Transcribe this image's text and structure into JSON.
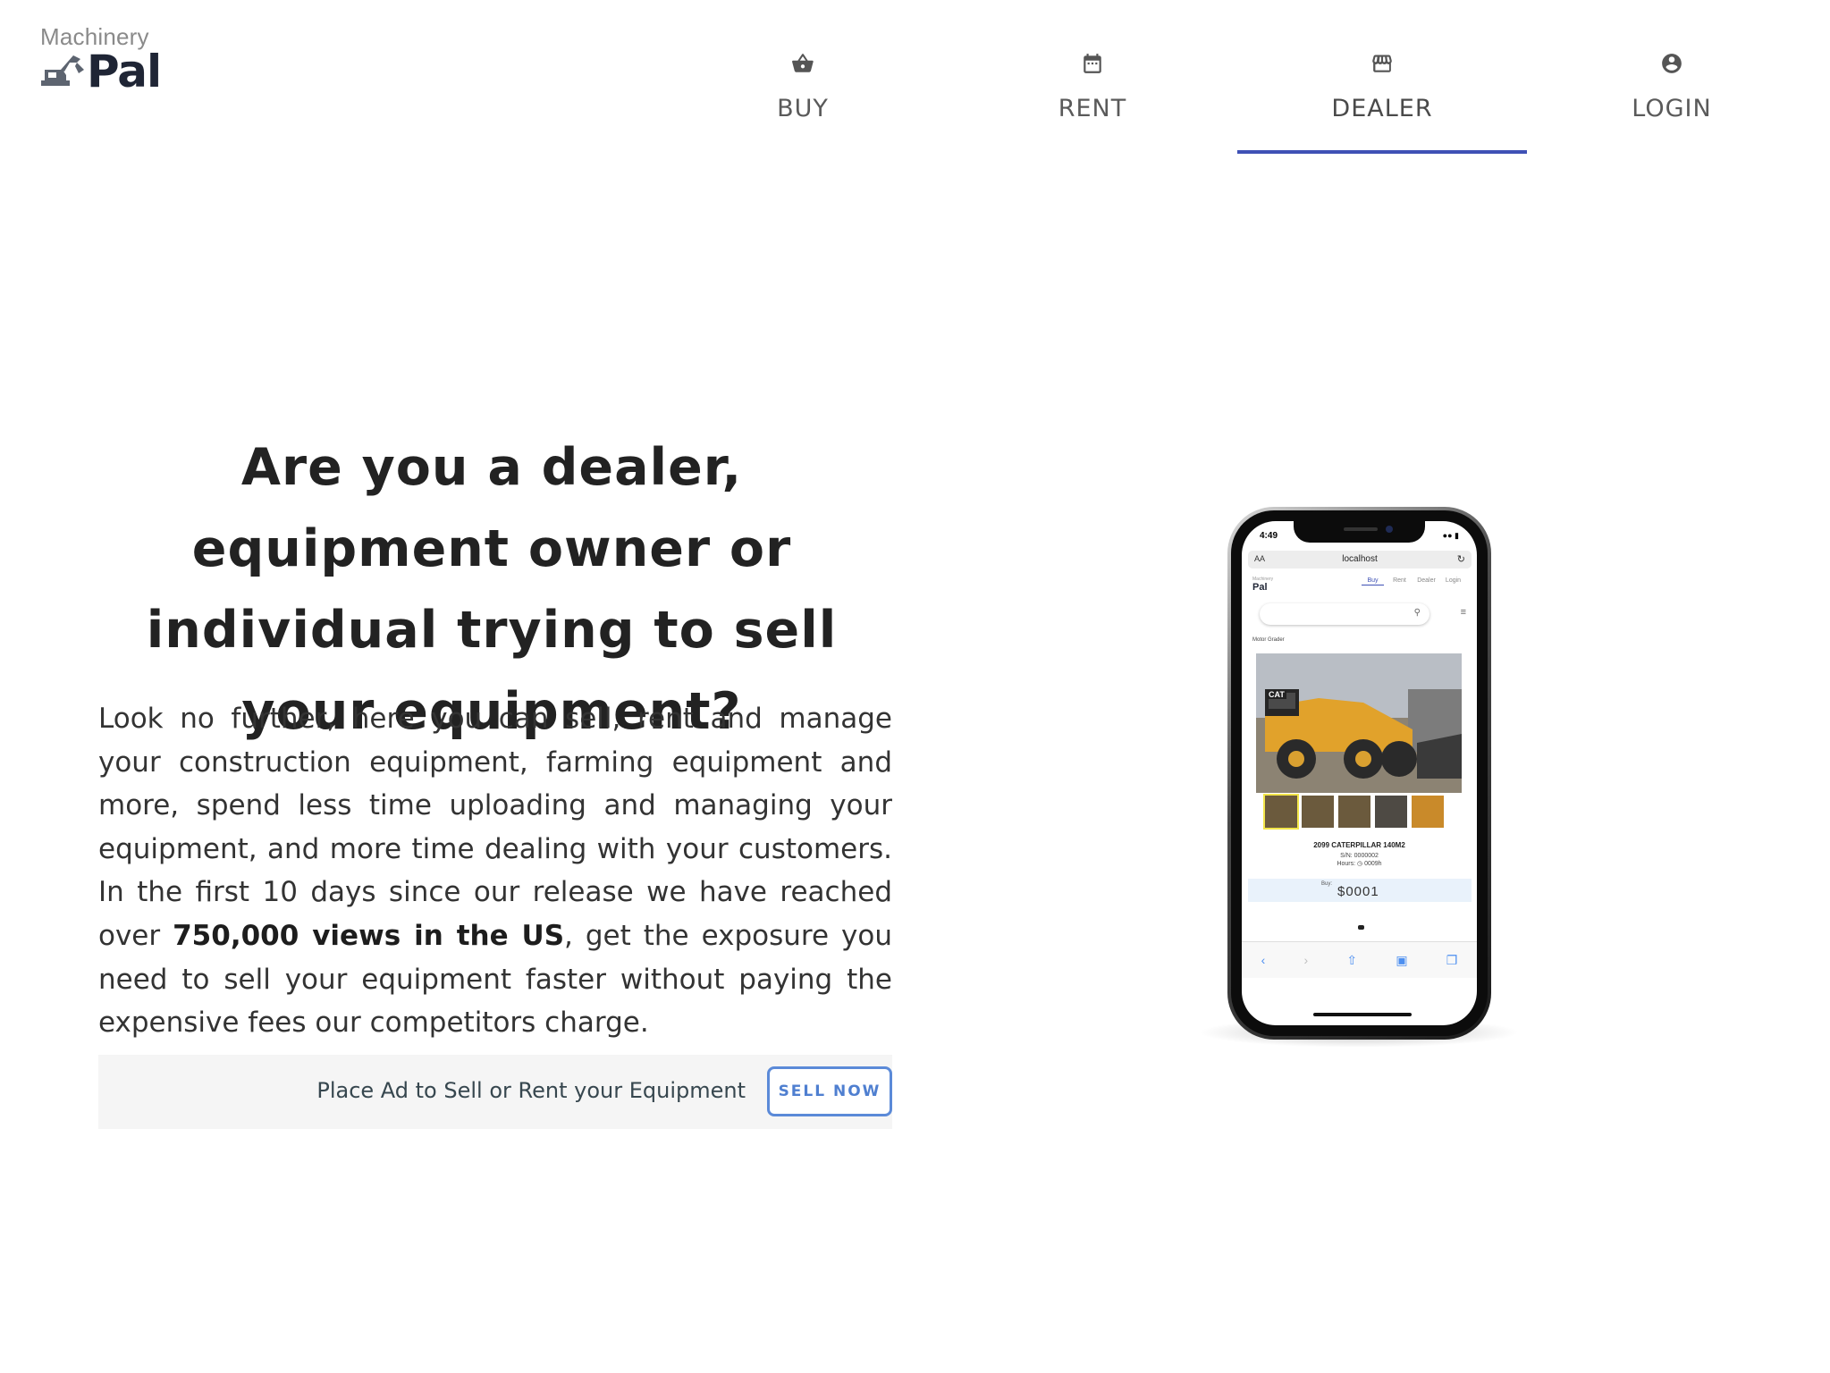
{
  "brand": {
    "top": "Machinery",
    "main": "Pal"
  },
  "nav": {
    "tabs": [
      {
        "label": "BUY",
        "icon": "basket-icon"
      },
      {
        "label": "RENT",
        "icon": "calendar-icon"
      },
      {
        "label": "DEALER",
        "icon": "storefront-icon",
        "active": true
      },
      {
        "label": "LOGIN",
        "icon": "account-circle-icon"
      }
    ],
    "accent": "#3f51b5"
  },
  "hero": {
    "headline": "Are you a dealer, equipment owner or individual trying to sell your equipment?",
    "body_before": "Look no further, here you can sell, rent and manage your construction equipment, farming equipment and more, spend less time uploading and managing your equipment, and more time dealing with your customers. In the first 10 days since our release we have reached over ",
    "body_bold": "750,000 views in the US",
    "body_after": ", get the exposure you need to sell your equipment faster without paying the expensive fees our competitors charge."
  },
  "cta": {
    "text": "Place Ad to Sell or Rent your Equipment",
    "button": "SELL NOW",
    "button_color": "#5b8ad8"
  },
  "phone": {
    "time": "4:49",
    "url_prefix": "AA",
    "url": "localhost",
    "mini_brand_top": "Machinery",
    "mini_brand": "Pal",
    "mini_tabs": [
      "Buy",
      "Rent",
      "Dealer",
      "Login"
    ],
    "category": "Motor Grader",
    "listing_title": "2099 CATERPILLAR 140M2",
    "serial_label": "S/N:",
    "serial": "0000002",
    "hours_label": "Hours:",
    "hours": "0009h",
    "price_label": "Buy:",
    "price": "$0001",
    "photo_brand": "CAT"
  }
}
